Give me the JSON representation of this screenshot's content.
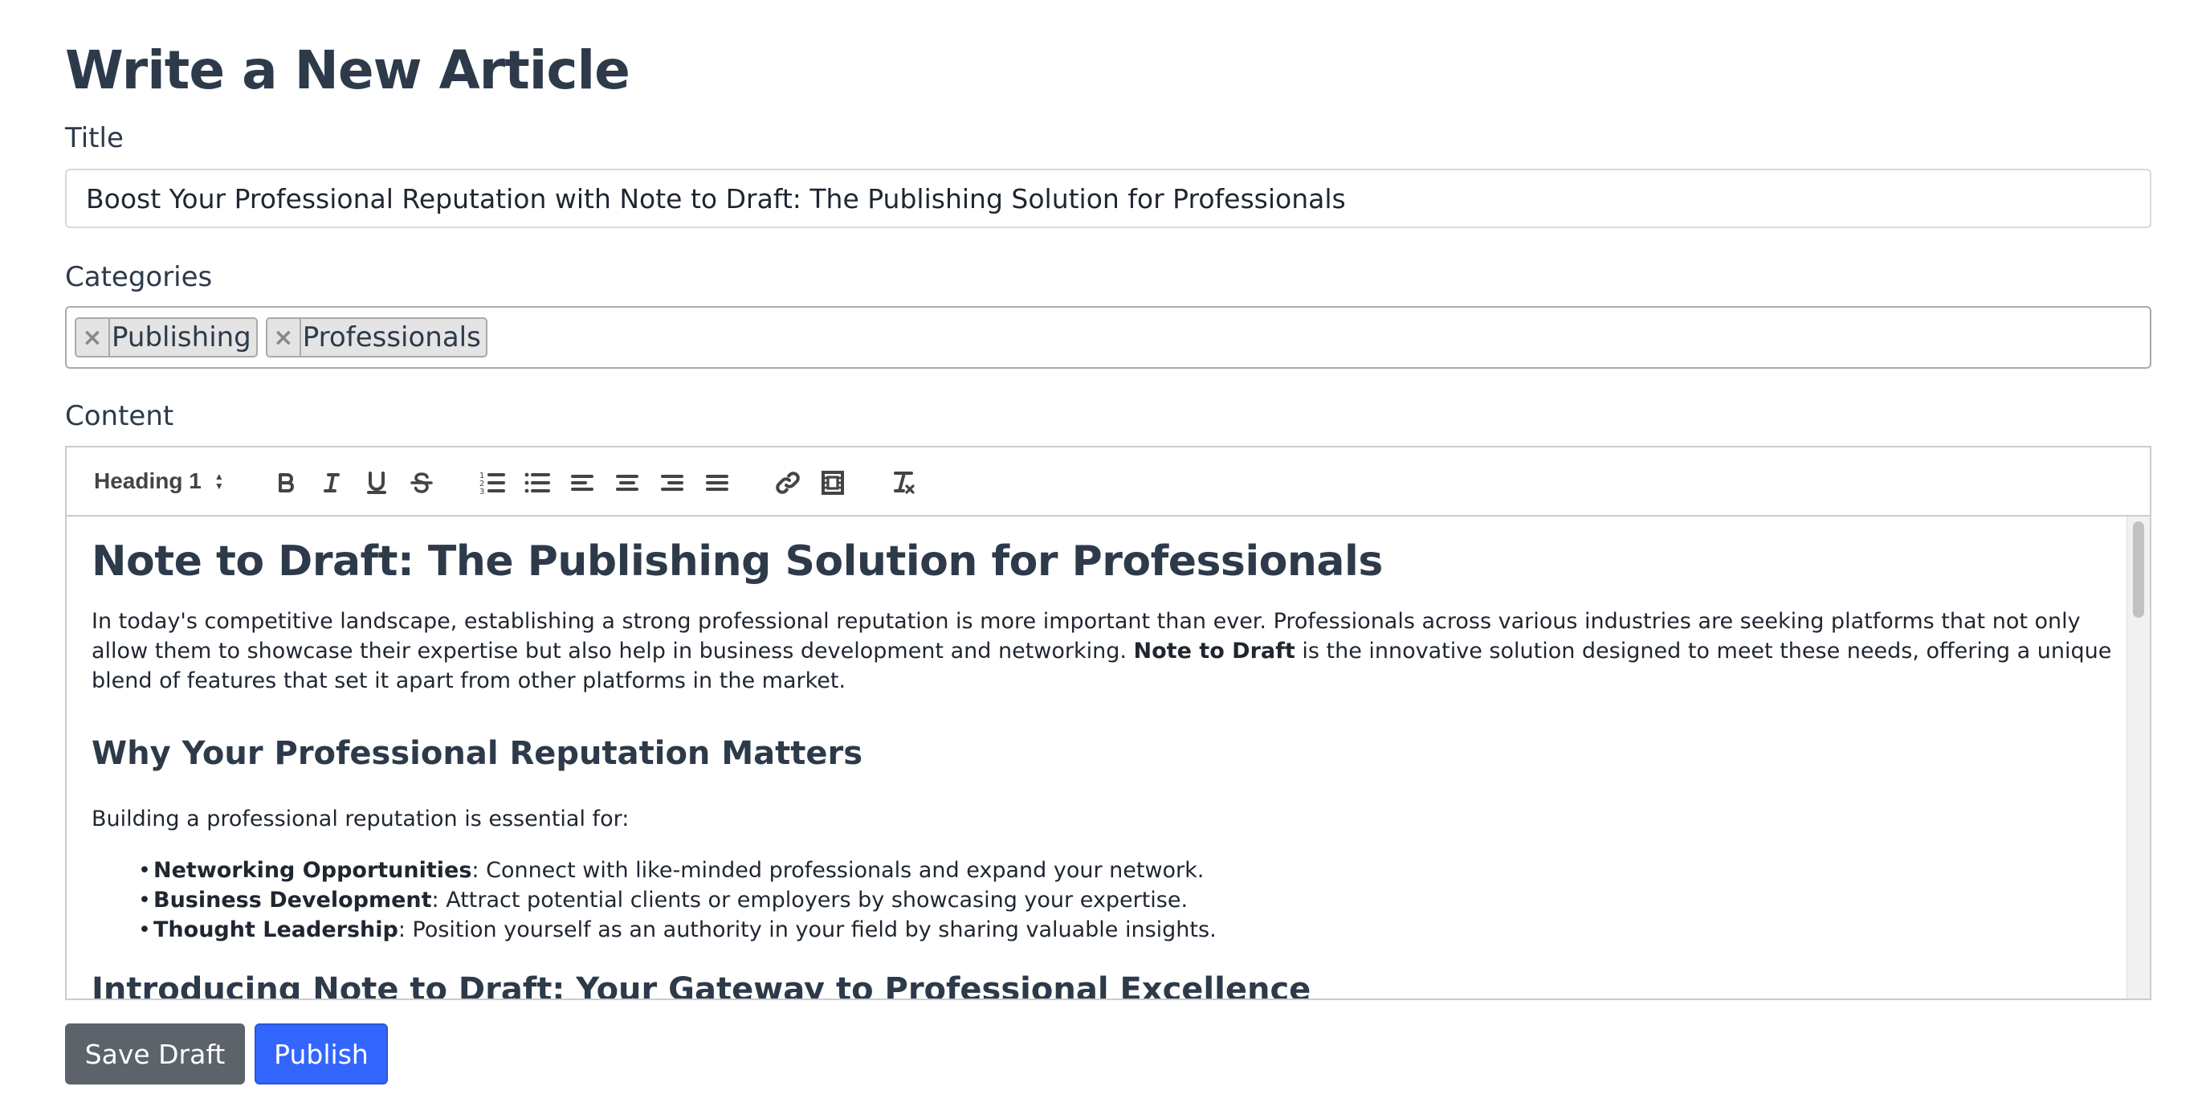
{
  "page": {
    "title": "Write a New Article"
  },
  "form": {
    "title_label": "Title",
    "title_value": "Boost Your Professional Reputation with Note to Draft: The Publishing Solution for Professionals",
    "categories_label": "Categories",
    "categories": [
      {
        "label": "Publishing",
        "remove": "×"
      },
      {
        "label": "Professionals",
        "remove": "×"
      }
    ],
    "content_label": "Content"
  },
  "toolbar": {
    "heading_select": "Heading 1",
    "buttons": [
      "bold",
      "italic",
      "underline",
      "strike",
      "ordered-list",
      "bullet-list",
      "align-left",
      "align-center",
      "align-right",
      "align-justify",
      "link",
      "video",
      "clean"
    ]
  },
  "content": {
    "h1": "Note to Draft: The Publishing Solution for Professionals",
    "intro_part1": "In today's competitive landscape, establishing a strong professional reputation is more important than ever. Professionals across various industries are seeking platforms that not only allow them to showcase their expertise but also help in business development and networking. ",
    "intro_bold": "Note to Draft",
    "intro_part2": " is the innovative solution designed to meet these needs, offering a unique blend of features that set it apart from other platforms in the market.",
    "h2_reputation": "Why Your Professional Reputation Matters",
    "building_text": "Building a professional reputation is essential for:",
    "bullets": [
      {
        "bold": "Networking Opportunities",
        "text": ": Connect with like-minded professionals and expand your network."
      },
      {
        "bold": "Business Development",
        "text": ": Attract potential clients or employers by showcasing your expertise."
      },
      {
        "bold": "Thought Leadership",
        "text": ": Position yourself as an authority in your field by sharing valuable insights."
      }
    ],
    "h2_intro": "Introducing Note to Draft: Your Gateway to Professional Excellence"
  },
  "actions": {
    "save_draft": "Save Draft",
    "publish": "Publish"
  },
  "colors": {
    "text": "#2d3a4a",
    "save_draft_bg": "#5c636a",
    "publish_bg": "#3366ff"
  }
}
